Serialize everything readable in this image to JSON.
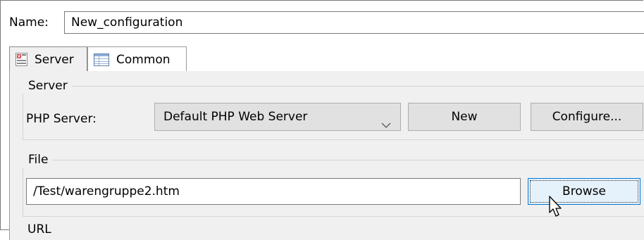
{
  "config": {
    "name_label": "Name:",
    "name_value": "New_configuration"
  },
  "tabs": [
    {
      "label": "Server",
      "icon": "server-icon",
      "selected": true
    },
    {
      "label": "Common",
      "icon": "table-icon",
      "selected": false
    }
  ],
  "server_group": {
    "title": "Server",
    "php_server_label": "PHP Server:",
    "php_server_selected": "Default PHP Web Server",
    "new_button": "New",
    "configure_button": "Configure..."
  },
  "file_group": {
    "title": "File",
    "path_value": "/Test/warengruppe2.htm",
    "browse_button": "Browse"
  },
  "url_group": {
    "title_partial": "URL"
  },
  "colors": {
    "panel_bg": "#f0f0f0",
    "focus_border": "#0078d7",
    "button_bg": "#e1e1e1"
  }
}
